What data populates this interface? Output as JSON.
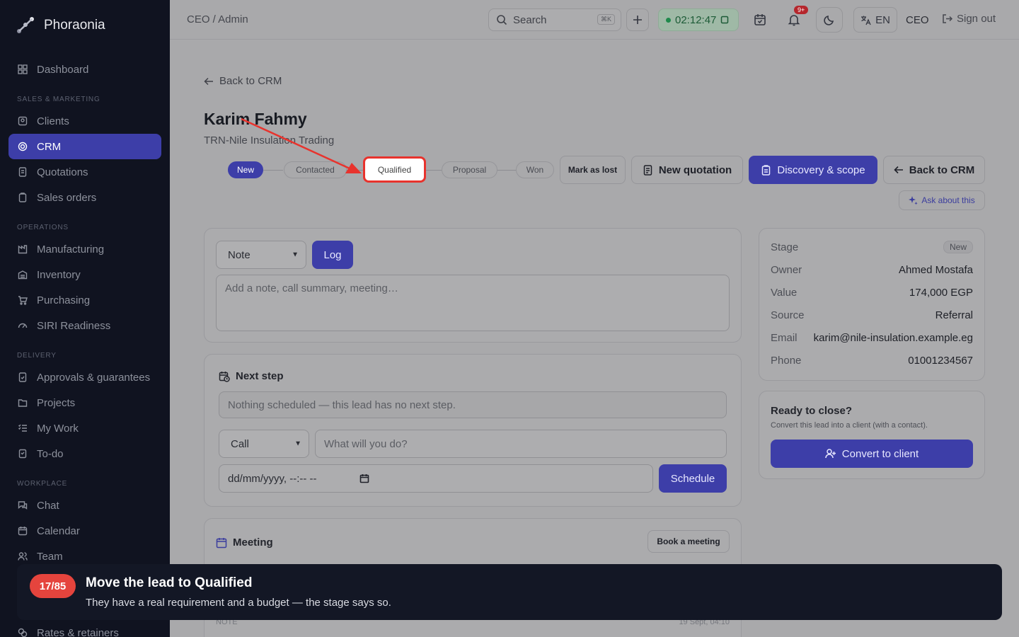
{
  "app": {
    "name": "Phoraonia"
  },
  "sidebar": {
    "items": {
      "dashboard": "Dashboard",
      "clients": "Clients",
      "crm": "CRM",
      "quotations": "Quotations",
      "sales_orders": "Sales orders",
      "manufacturing": "Manufacturing",
      "inventory": "Inventory",
      "purchasing": "Purchasing",
      "siri": "SIRI Readiness",
      "approvals": "Approvals & guarantees",
      "projects": "Projects",
      "my_work": "My Work",
      "todo": "To-do",
      "chat": "Chat",
      "calendar": "Calendar",
      "team": "Team",
      "rates": "Rates & retainers"
    },
    "sections": {
      "sales": "SALES & MARKETING",
      "operations": "OPERATIONS",
      "delivery": "DELIVERY",
      "workplace": "WORKPLACE"
    }
  },
  "topbar": {
    "breadcrumb": "CEO / Admin",
    "search_label": "Search",
    "search_kbd": "⌘K",
    "timer": "02:12:47",
    "notifications_badge": "9+",
    "language": "EN",
    "role": "CEO",
    "sign_out": "Sign out"
  },
  "lead": {
    "back_label": "Back to CRM",
    "name": "Karim Fahmy",
    "company": "TRN-Nile Insulation Trading",
    "stages": [
      "New",
      "Contacted",
      "Qualified",
      "Proposal",
      "Won"
    ],
    "current_stage": "New",
    "mark_lost": "Mark as lost",
    "new_quotation": "New quotation",
    "discovery": "Discovery & scope",
    "back_crm": "Back to CRM",
    "ask": "Ask about this"
  },
  "log": {
    "type": "Note",
    "button": "Log",
    "placeholder": "Add a note, call summary, meeting…"
  },
  "next_step": {
    "title": "Next step",
    "empty": "Nothing scheduled — this lead has no next step.",
    "type": "Call",
    "placeholder": "What will you do?",
    "datetime": "dd/mm/yyyy, --:-- --",
    "schedule": "Schedule"
  },
  "meeting": {
    "title": "Meeting",
    "book": "Book a meeting"
  },
  "details": {
    "stage_label": "Stage",
    "stage_value": "New",
    "owner_label": "Owner",
    "owner_value": "Ahmed Mostafa",
    "value_label": "Value",
    "value_value": "174,000 EGP",
    "source_label": "Source",
    "source_value": "Referral",
    "email_label": "Email",
    "email_value": "karim@nile-insulation.example.eg",
    "phone_label": "Phone",
    "phone_value": "01001234567"
  },
  "close": {
    "title": "Ready to close?",
    "sub": "Convert this lead into a client (with a contact).",
    "button": "Convert to client"
  },
  "activity": {
    "type": "NOTE",
    "date": "19 Sept, 04:10"
  },
  "tour": {
    "count": "17/85",
    "title": "Move the lead to Qualified",
    "subtitle": "They have a real requirement and a budget — the stage says so."
  },
  "colors": {
    "accent": "#3d3ea8",
    "highlight": "#e8332d",
    "sidebar": "#101320"
  }
}
